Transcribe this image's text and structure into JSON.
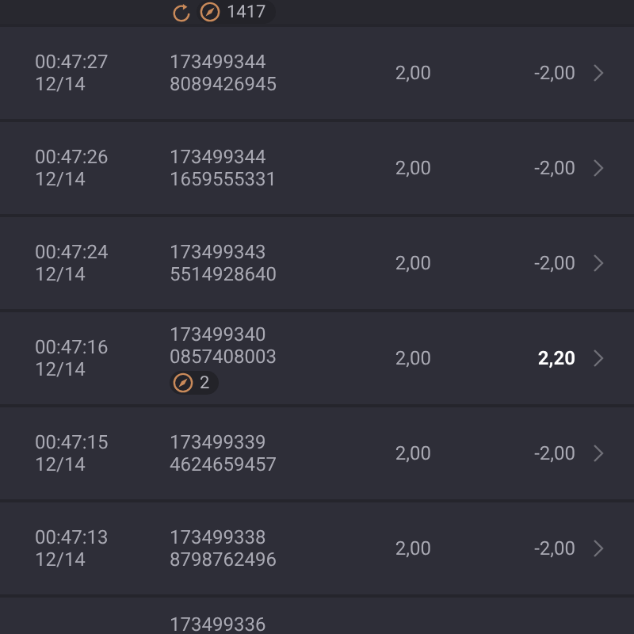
{
  "top_row": {
    "badge_count": "1417"
  },
  "rows": [
    {
      "time": "00:47:27",
      "date": "12/14",
      "id_lines": [
        "173499344",
        "8089426945"
      ],
      "amount": "2,00",
      "result": "-2,00",
      "won": false
    },
    {
      "time": "00:47:26",
      "date": "12/14",
      "id_lines": [
        "173499344",
        "1659555331"
      ],
      "amount": "2,00",
      "result": "-2,00",
      "won": false
    },
    {
      "time": "00:47:24",
      "date": "12/14",
      "id_lines": [
        "173499343",
        "5514928640"
      ],
      "amount": "2,00",
      "result": "-2,00",
      "won": false
    },
    {
      "time": "00:47:16",
      "date": "12/14",
      "id_lines": [
        "173499340",
        "0857408003"
      ],
      "amount": "2,00",
      "result": "2,20",
      "won": true,
      "badge_count": "2"
    },
    {
      "time": "00:47:15",
      "date": "12/14",
      "id_lines": [
        "173499339",
        "4624659457"
      ],
      "amount": "2,00",
      "result": "-2,00",
      "won": false
    },
    {
      "time": "00:47:13",
      "date": "12/14",
      "id_lines": [
        "173499338",
        "8798762496"
      ],
      "amount": "2,00",
      "result": "-2,00",
      "won": false
    }
  ],
  "partial_row": {
    "id_lines": [
      "173499336"
    ]
  }
}
